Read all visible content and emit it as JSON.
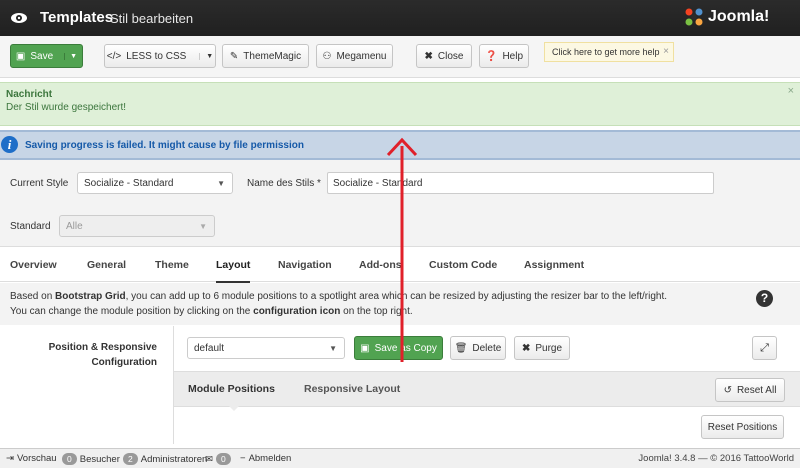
{
  "titlebar": {
    "title": "Templates",
    "subtitle": "Stil bearbeiten",
    "logo_text": "Joomla!"
  },
  "toolbar": {
    "save": "Save",
    "less": "LESS to CSS",
    "thememagic": "ThemeMagic",
    "megamenu": "Megamenu",
    "close": "Close",
    "help": "Help",
    "tip": "Click here to get more help",
    "tip_close": "×"
  },
  "message": {
    "heading": "Nachricht",
    "body": "Der Stil wurde gespeichert!",
    "close": "×"
  },
  "warning": {
    "icon_glyph": "i",
    "text": "Saving progress is failed. It might cause by file permission"
  },
  "form": {
    "current_style_label": "Current Style",
    "current_style_value": "Socialize - Standard",
    "style_name_label": "Name des Stils *",
    "style_name_value": "Socialize - Standard",
    "standard_label": "Standard",
    "standard_value": "Alle"
  },
  "tabs": [
    "Overview",
    "General",
    "Theme",
    "Layout",
    "Navigation",
    "Add-ons",
    "Custom Code",
    "Assignment"
  ],
  "description": {
    "l1_pre": "Based on ",
    "l1_bold": "Bootstrap Grid",
    "l1_post": ", you can add up to 6 module positions to a spotlight area which can be resized by adjusting the resizer bar to the left/right.",
    "l2_pre": "You can change the module position by clicking on the ",
    "l2_bold": "configuration icon",
    "l2_post": " on the top right.",
    "help_glyph": "?"
  },
  "layout": {
    "label": "Position & Responsive Configuration",
    "select_value": "default",
    "save_as_copy": "Save as Copy",
    "delete": "Delete",
    "purge": "Purge",
    "subtab_module": "Module Positions",
    "subtab_responsive": "Responsive Layout",
    "reset_all": "Reset All",
    "reset_positions": "Reset Positions"
  },
  "status": {
    "preview": "Vorschau",
    "visitors_count": "0",
    "visitors": "Besucher",
    "admins_count": "2",
    "admins": "Administratoren",
    "messages_count": "0",
    "logout": "Abmelden",
    "version": "Joomla! 3.4.8 — © 2016 TattooWorld"
  },
  "colors": {
    "save_green": "#51a351",
    "annotation_arrow": "#e0202a",
    "warning_text": "#1559a8"
  }
}
